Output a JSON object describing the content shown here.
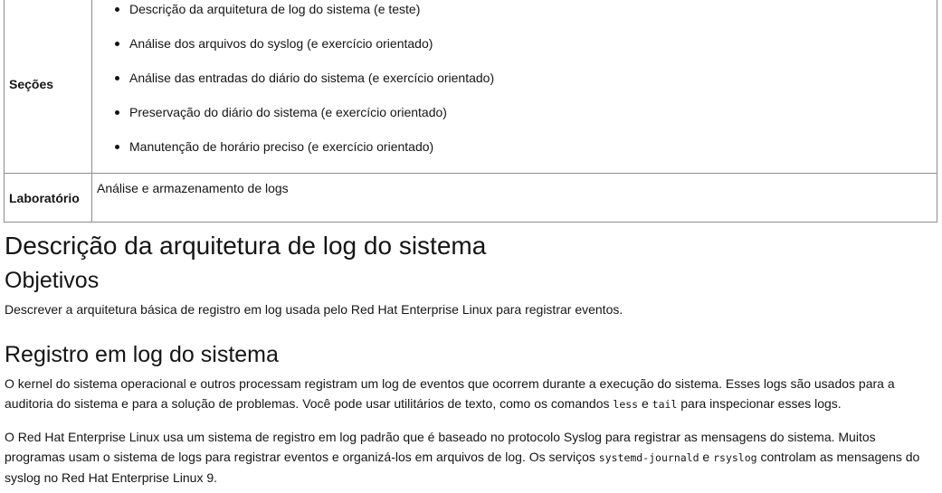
{
  "outline": {
    "sections_label": "Seções",
    "sections": [
      "Descrição da arquitetura de log do sistema (e teste)",
      "Análise dos arquivos do syslog (e exercício orientado)",
      "Análise das entradas do diário do sistema (e exercício orientado)",
      "Preservação do diário do sistema (e exercício orientado)",
      "Manutenção de horário preciso (e exercício orientado)"
    ],
    "lab_label": "Laboratório",
    "lab_value": "Análise e armazenamento de logs"
  },
  "doc": {
    "title": "Descrição da arquitetura de log do sistema",
    "objectives_heading": "Objetivos",
    "objectives_text": "Descrever a arquitetura básica de registro em log usada pelo Red Hat Enterprise Linux para registrar eventos.",
    "section_heading": "Registro em log do sistema",
    "para1": {
      "text_a": "O kernel do sistema operacional e outros processam registram um log de eventos que ocorrem durante a execução do sistema. Esses logs são usados para a auditoria do sistema e para a solução de problemas. Você pode usar utilitários de texto, como os comandos ",
      "code1": "less",
      "text_b": " e ",
      "code2": "tail",
      "text_c": " para inspecionar esses logs."
    },
    "para2": {
      "text_a": "O Red Hat Enterprise Linux usa um sistema de registro em log padrão que é baseado no protocolo Syslog para registrar as mensagens do sistema. Muitos programas usam o sistema de logs para registrar eventos e organizá-los em arquivos de log. Os serviços ",
      "code1": "systemd-journald",
      "text_b": " e ",
      "code2": "rsyslog",
      "text_c": " controlam as mensagens do syslog no Red Hat Enterprise Linux 9."
    }
  }
}
